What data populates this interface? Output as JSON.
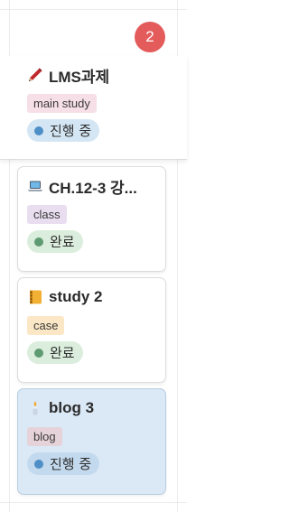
{
  "column": {
    "count": "2",
    "badge_color": "#e45b5b"
  },
  "cards": [
    {
      "icon": "pencil-icon",
      "title": "LMS과제",
      "tag": "main study",
      "tag_color": "#f6dfe6",
      "status": "진행 중",
      "status_bg": "#d4e6f4",
      "status_dot": "#4d8fc6"
    },
    {
      "icon": "laptop-icon",
      "title": "CH.12-3 강...",
      "tag": "class",
      "tag_color": "#e8def0",
      "status": "완료",
      "status_bg": "#dbeddc",
      "status_dot": "#5e9b72"
    },
    {
      "icon": "notebook-icon",
      "title": "study 2",
      "tag": "case",
      "tag_color": "#fbe7c6",
      "status": "완료",
      "status_bg": "#dbeddc",
      "status_dot": "#5e9b72"
    },
    {
      "icon": "candle-icon",
      "title": "blog 3",
      "tag": "blog",
      "tag_color": "#e6d3da",
      "status": "진행 중",
      "status_bg": "#c3d9ed",
      "status_dot": "#4d8fc6"
    }
  ]
}
